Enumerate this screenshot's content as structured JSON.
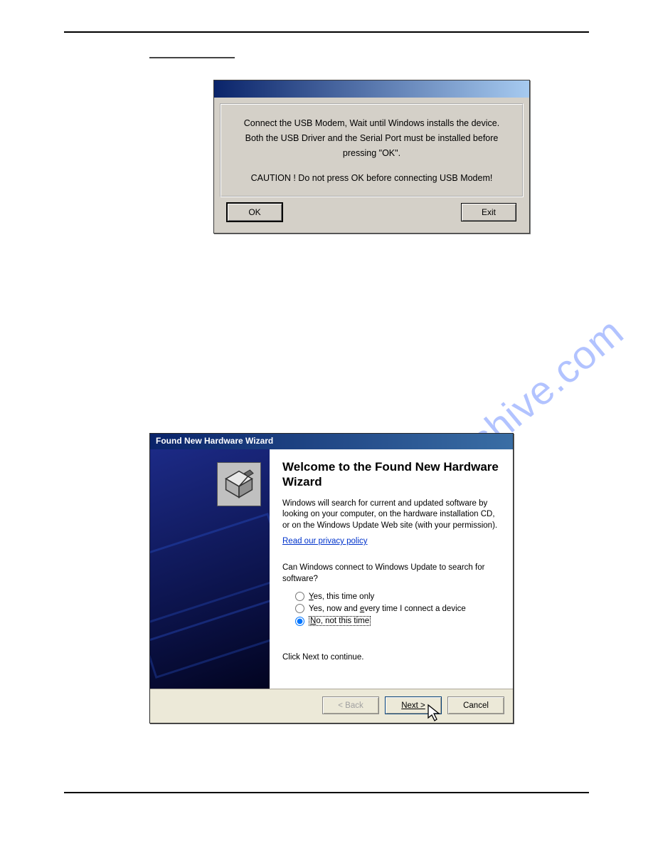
{
  "msgbox": {
    "line1": "Connect the USB Modem, Wait until Windows installs the device.",
    "line2": "Both the USB Driver and the Serial Port must be installed before",
    "line3": "pressing \"OK\".",
    "caution": "CAUTION ! Do not press OK before connecting USB Modem!",
    "ok_label": "OK",
    "exit_label": "Exit"
  },
  "watermark": "manualshive.com",
  "wizard": {
    "title": "Found New Hardware Wizard",
    "heading": "Welcome to the Found New Hardware Wizard",
    "desc": "Windows will search for current and updated software by looking on your computer, on the hardware installation CD, or on the Windows Update Web site (with your permission).",
    "privacy_link": "Read our privacy policy",
    "question": "Can Windows connect to Windows Update to search for software?",
    "radio1_pre": "Y",
    "radio1_post": "es, this time only",
    "radio2_pre": "Yes, now and ",
    "radio2_mn": "e",
    "radio2_post": "very time I connect a device",
    "radio3_pre": "N",
    "radio3_post": "o, not this time",
    "continue": "Click Next to continue.",
    "back_label": "< Back",
    "next_label": "Next >",
    "cancel_label": "Cancel"
  }
}
